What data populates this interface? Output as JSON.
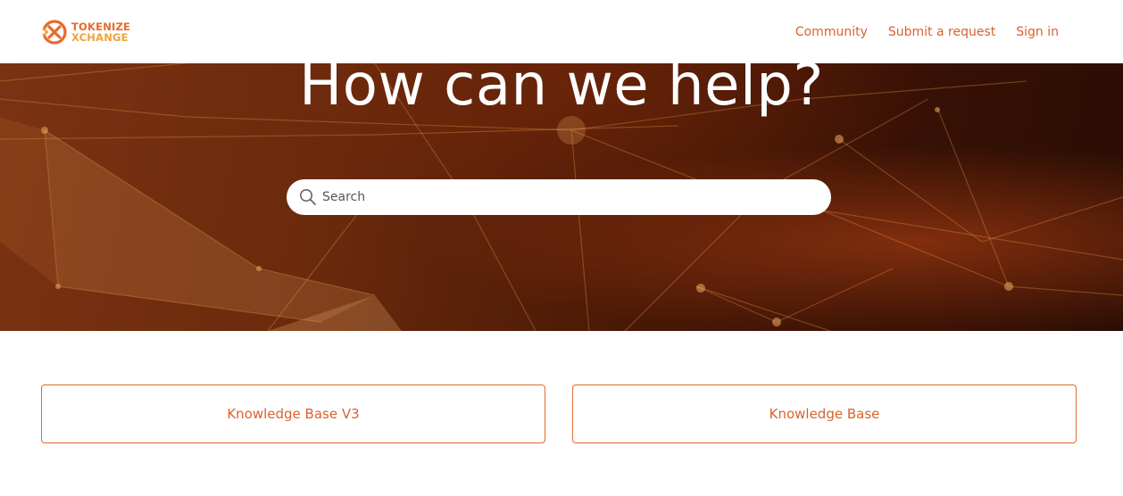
{
  "brand": {
    "line1": "TOKENIZE",
    "line2": "XCHANGE",
    "colors": {
      "primary": "#e9692c",
      "secondary": "#f0a33a"
    },
    "icon": "tokenize-logo-icon"
  },
  "nav": {
    "community": "Community",
    "submit_request": "Submit a request",
    "sign_in": "Sign in"
  },
  "hero": {
    "title": "How can we help?",
    "search": {
      "placeholder": "Search",
      "value": "",
      "icon": "search-icon"
    }
  },
  "categories": [
    {
      "label": "Knowledge Base V3"
    },
    {
      "label": "Knowledge Base"
    }
  ],
  "colors": {
    "accent": "#d9622b",
    "hero_bg": "#5a200a",
    "card_border": "#e06a2e"
  }
}
